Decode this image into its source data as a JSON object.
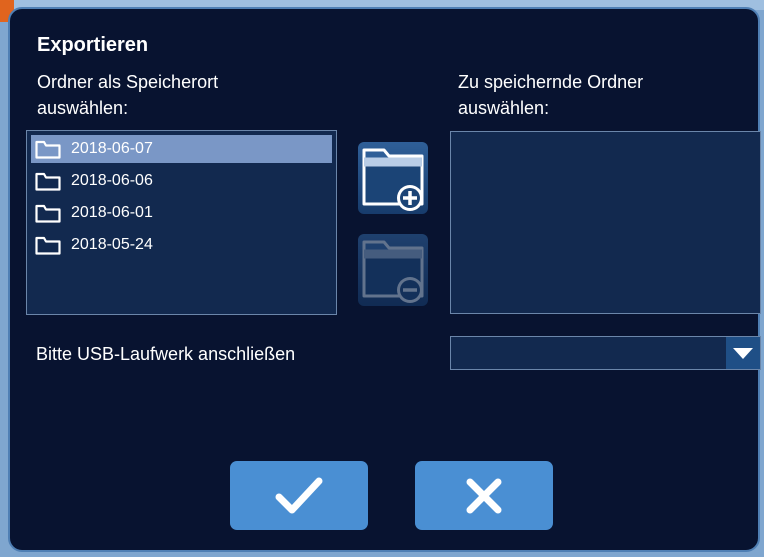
{
  "dialog": {
    "title": "Exportieren",
    "left_label": "Ordner als Speicherort auswählen:",
    "right_label": "Zu speichernde Ordner auswählen:",
    "usb_label": "Bitte USB-Laufwerk anschließen",
    "usb_dropdown_value": ""
  },
  "source_folders": [
    {
      "name": "2018-06-07",
      "selected": true
    },
    {
      "name": "2018-06-06",
      "selected": false
    },
    {
      "name": "2018-06-01",
      "selected": false
    },
    {
      "name": "2018-05-24",
      "selected": false
    }
  ],
  "target_folders": [],
  "icons": {
    "add": "folder-add-icon",
    "remove": "folder-remove-icon",
    "confirm": "checkmark-icon",
    "cancel": "close-icon",
    "dropdown": "chevron-down-icon",
    "folder": "folder-icon"
  },
  "colors": {
    "background": "#081330",
    "selection": "#7a97c6",
    "button": "#4a8fd3",
    "accent_corner": "#e0641e"
  }
}
